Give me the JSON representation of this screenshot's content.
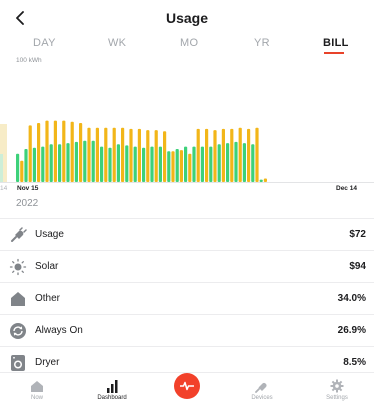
{
  "header": {
    "title": "Usage",
    "back_icon": "chevron-left-icon"
  },
  "tabs": [
    {
      "label": "DAY",
      "active": false
    },
    {
      "label": "WK",
      "active": false
    },
    {
      "label": "MO",
      "active": false
    },
    {
      "label": "YR",
      "active": false
    },
    {
      "label": "BILL",
      "active": true
    }
  ],
  "colors": {
    "usage": "#f2b619",
    "solar": "#3dd17a",
    "accent": "#e8432a"
  },
  "chart_data": {
    "type": "bar",
    "ylabel": "100 kWh",
    "x_start_label": "Nov 15",
    "x_end_label": "Dec 14",
    "left_edge_label": "14",
    "series": [
      {
        "values": [
          18,
          48,
          50,
          52,
          52,
          52,
          51,
          50,
          46,
          46,
          46,
          46,
          46,
          45,
          45,
          44,
          44,
          43,
          26,
          27,
          24,
          45,
          45,
          44,
          45,
          45,
          46,
          45,
          46,
          3
        ]
      },
      {
        "values": [
          24,
          28,
          29,
          30,
          32,
          32,
          33,
          34,
          35,
          35,
          30,
          29,
          32,
          31,
          30,
          29,
          30,
          30,
          26,
          28,
          30,
          30,
          30,
          30,
          32,
          33,
          34,
          33,
          32,
          2
        ]
      }
    ],
    "grid": false
  },
  "year_label": "2022",
  "list": [
    {
      "label": "Usage",
      "value": "$72",
      "icon": "plug-icon"
    },
    {
      "label": "Solar",
      "value": "$94",
      "icon": "sun-icon"
    },
    {
      "label": "Other",
      "value": "34.0%",
      "icon": "house-icon"
    },
    {
      "label": "Always On",
      "value": "26.9%",
      "icon": "refresh-icon"
    },
    {
      "label": "Dryer",
      "value": "8.5%",
      "icon": "dryer-icon"
    }
  ],
  "nav": [
    {
      "label": "Now",
      "icon": "house-icon",
      "active": false
    },
    {
      "label": "Dashboard",
      "icon": "bars-icon",
      "active": true
    },
    {
      "label": "",
      "icon": "pulse-icon",
      "active": false
    },
    {
      "label": "Devices",
      "icon": "plug-icon",
      "active": false
    },
    {
      "label": "Settings",
      "icon": "gear-icon",
      "active": false
    }
  ]
}
